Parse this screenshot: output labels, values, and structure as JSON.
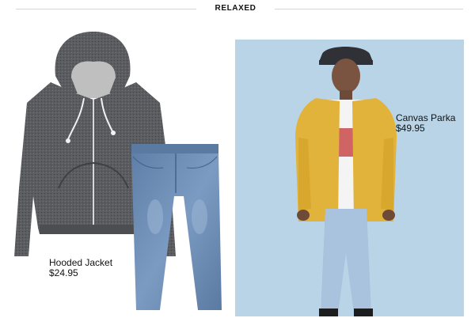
{
  "header": {
    "title": "RELAXED"
  },
  "products": {
    "hooded_jacket": {
      "name": "Hooded Jacket",
      "price": "$24.95"
    },
    "canvas_parka": {
      "name": "Canvas Parka",
      "price": "$49.95"
    }
  },
  "colors": {
    "background": "#ffffff",
    "model_panel_bg": "#b9d4e7",
    "hoodie_gray": "#56575a",
    "denim_blue": "#6f8fb5",
    "parka_yellow": "#e2b33a",
    "text": "#111111"
  }
}
